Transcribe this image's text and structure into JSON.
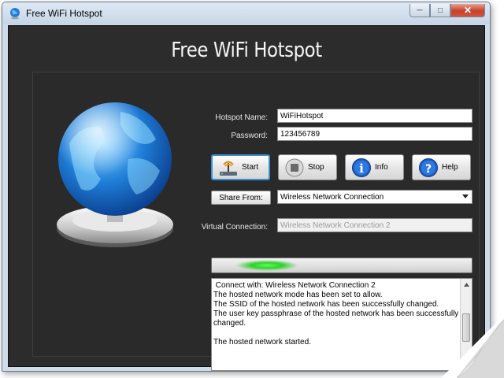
{
  "window": {
    "title": "Free WiFi Hotspot"
  },
  "header": {
    "title": "Free WiFi Hotspot"
  },
  "form": {
    "hotspot_name_label": "Hotspot Name:",
    "hotspot_name_value": "WiFiHotspot",
    "password_label": "Password:",
    "password_value": "123456789",
    "share_from_label": "Share From:",
    "share_from_value": "Wireless Network Connection",
    "virtual_connection_label": "Virtual Connection:",
    "virtual_connection_value": "Wireless Network Connection 2"
  },
  "buttons": {
    "start": "Start",
    "stop": "Stop",
    "info": "Info",
    "help": "Help"
  },
  "log": {
    "lines": [
      " Connect with: Wireless Network Connection 2",
      "The hosted network mode has been set to allow.",
      "The SSID of the hosted network has been successfully changed.",
      "The user key passphrase of the hosted network has been successfully changed.",
      "",
      "The hosted network started."
    ]
  },
  "colors": {
    "accent_blue": "#3a8fd8",
    "background_dark": "#2c2c2c",
    "progress_green": "#2ed22a"
  },
  "icons": {
    "app": "globe-icon",
    "start": "wifi-antenna-icon",
    "stop": "stop-icon",
    "info": "info-icon",
    "help": "help-icon"
  }
}
